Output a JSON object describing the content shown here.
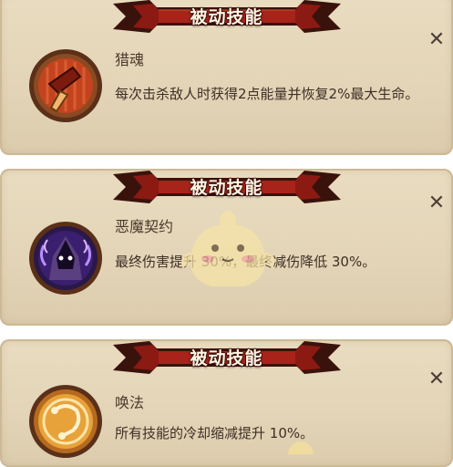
{
  "panels": [
    {
      "banner_title": "被动技能",
      "skill_name": "猎魂",
      "description": "每次击杀敌人时获得2点能量并恢复2%最大生命。",
      "icon": "hammer-icon",
      "icon_colors": {
        "ring": "#6e3a1f",
        "fill": "#c4431f",
        "accent": "#f0b86e"
      }
    },
    {
      "banner_title": "被动技能",
      "skill_name": "恶魔契约",
      "description": "最终伤害提升 30%，最终减伤降低 30%。",
      "icon": "hooded-demon-icon",
      "icon_colors": {
        "ring": "#6e3a1f",
        "fill": "#3a1f6e",
        "accent": "#b88cff"
      }
    },
    {
      "banner_title": "被动技能",
      "skill_name": "唤法",
      "description": "所有技能的冷却缩减提升 10%。",
      "icon": "golden-rune-icon",
      "icon_colors": {
        "ring": "#6e3a1f",
        "fill": "#e8a23a",
        "accent": "#fbe5a8"
      }
    }
  ],
  "close_icon": "close-icon",
  "watermark": "mascot-watermark",
  "colors": {
    "banner_red": "#8b1a12",
    "banner_dark": "#3a120c",
    "panel_bg": "#e6d8bb",
    "text": "#3c2f25"
  }
}
